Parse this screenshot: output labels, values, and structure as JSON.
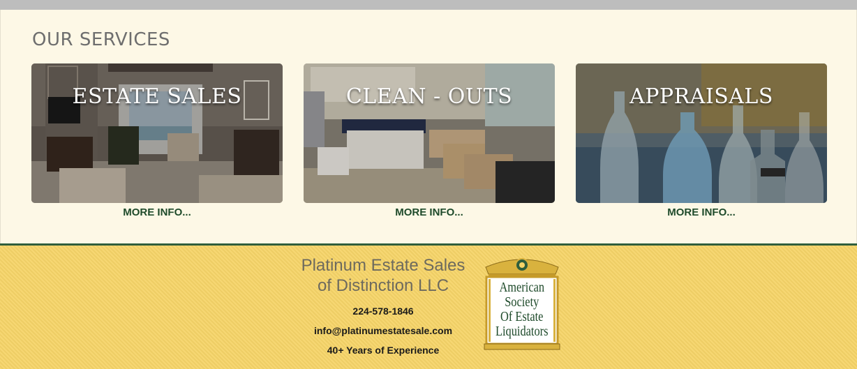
{
  "services": {
    "title": "OUR SERVICES",
    "cards": [
      {
        "title": "ESTATE SALES",
        "link": "MORE INFO..."
      },
      {
        "title": "CLEAN - OUTS",
        "link": "MORE INFO..."
      },
      {
        "title": "APPRAISALS",
        "link": "MORE INFO..."
      }
    ]
  },
  "footer": {
    "company_line1": "Platinum Estate Sales",
    "company_line2": "of Distinction LLC",
    "phone": "224-578-1846",
    "email": "info@platinumestatesale.com",
    "experience": "40+ Years of Experience",
    "badge": {
      "line1": "American",
      "line2": "Society",
      "line3": "Of Estate",
      "line4": "Liquidators"
    }
  },
  "colors": {
    "accent_green": "#1e4a2a",
    "footer_bg": "#f6d468",
    "page_bg": "#fdf8e6"
  }
}
